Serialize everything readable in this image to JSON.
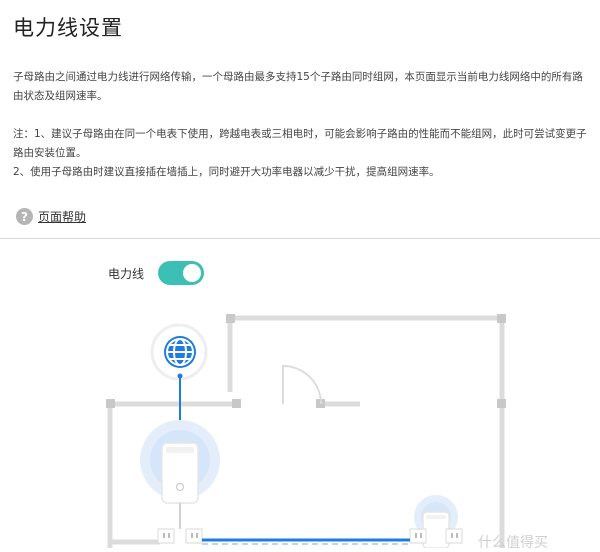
{
  "page": {
    "title": "电力线设置",
    "description": "子母路由之间通过电力线进行网络传输，一个母路由最多支持15个子路由同时组网，本页面显示当前电力线网络中的所有路由状态及组网速率。",
    "notes": [
      "注：1、建议子母路由在同一个电表下使用，跨越电表或三相电时，可能会影响子路由的性能而不能组网，此时可尝试变更子路由安装位置。",
      "2、使用子母路由时建议直接插在墙插上，同时避开大功率电器以减少干扰，提高组网速率。"
    ],
    "help_link": "页面帮助"
  },
  "powerline": {
    "label": "电力线",
    "enabled": true
  },
  "icons": {
    "help": "question-circle-icon",
    "internet": "globe-icon",
    "router_main": "router-icon",
    "router_sub": "router-icon"
  },
  "colors": {
    "accent": "#3cbfb4",
    "link_line": "#1e7be0",
    "glow": "#d6e8fb",
    "wall": "#dcdcdc"
  },
  "watermark": "什么值得买"
}
